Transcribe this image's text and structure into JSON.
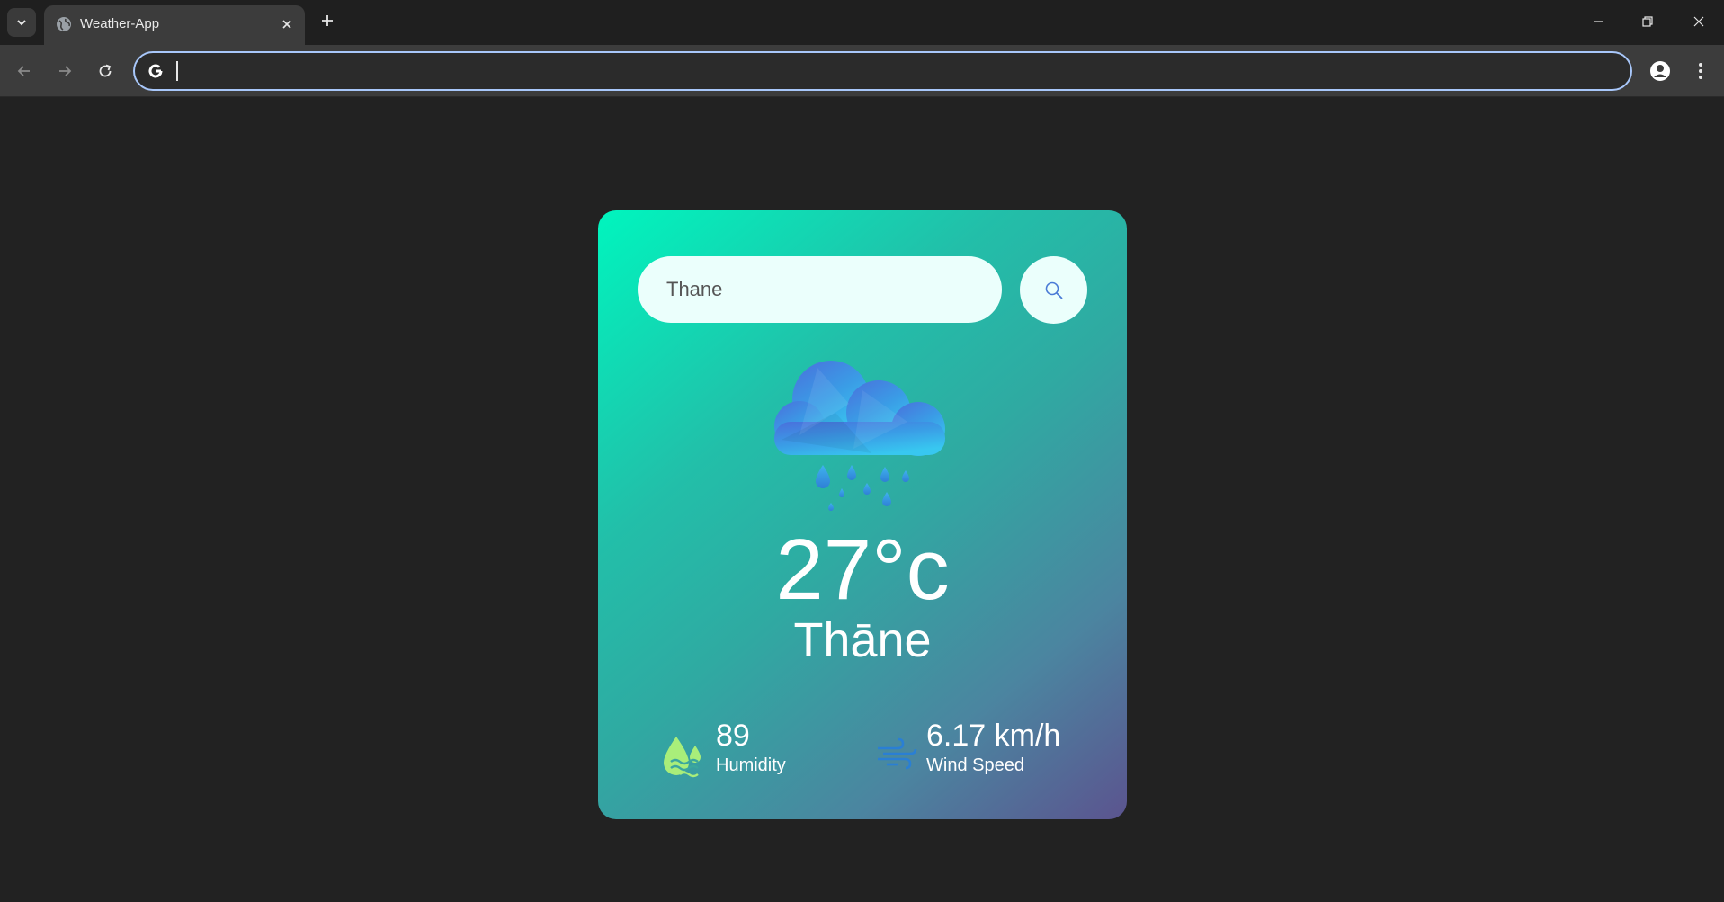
{
  "browser": {
    "tab_title": "Weather-App",
    "address_value": "",
    "icons": {
      "tab_search": "chevron-down-icon",
      "favicon": "globe-icon",
      "tab_close": "close-icon",
      "new_tab": "plus-icon",
      "minimize": "minimize-icon",
      "restore": "restore-icon",
      "close_window": "close-icon",
      "back": "arrow-left-icon",
      "forward": "arrow-right-icon",
      "reload": "reload-icon",
      "search_engine": "google-icon",
      "profile": "profile-icon",
      "menu": "kebab-menu-icon"
    }
  },
  "weather": {
    "search_value": "Thane",
    "search_icon": "search-icon",
    "condition_icon": "rain-cloud-icon",
    "temperature": "27°c",
    "city": "Thāne",
    "humidity": {
      "value": "89",
      "label": "Humidity",
      "icon": "humidity-icon"
    },
    "wind": {
      "value": "6.17 km/h",
      "label": "Wind Speed",
      "icon": "wind-icon"
    }
  },
  "colors": {
    "page_background": "#222222",
    "card_gradient_start": "#00f5be",
    "card_gradient_end": "#5b548f",
    "search_background": "#ebfffc",
    "omnibox_focus": "#a8c7fa"
  }
}
